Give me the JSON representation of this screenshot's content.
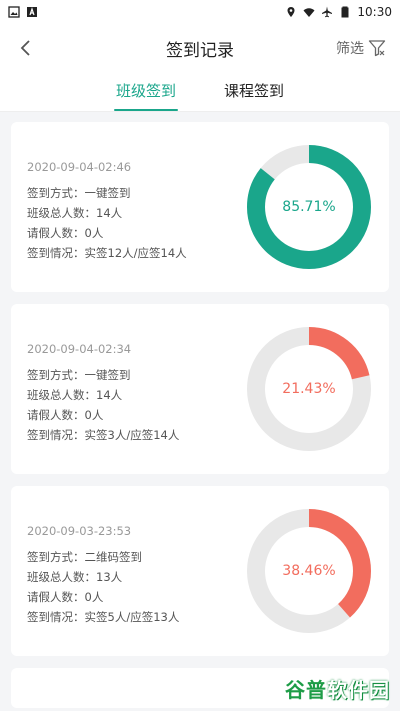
{
  "status_bar": {
    "time": "10:30"
  },
  "nav": {
    "title": "签到记录",
    "filter_label": "筛选"
  },
  "tabs": [
    {
      "label": "班级签到",
      "active": true
    },
    {
      "label": "课程签到",
      "active": false
    }
  ],
  "records": [
    {
      "datetime": "2020-09-04-02:46",
      "method": "签到方式：一键签到",
      "total": "班级总人数：14人",
      "leave": "请假人数：0人",
      "status": "签到情况：实签12人/应签14人",
      "percent_label": "85.71%",
      "rate": 0.8571,
      "color": "#1aa68b"
    },
    {
      "datetime": "2020-09-04-02:34",
      "method": "签到方式：一键签到",
      "total": "班级总人数：14人",
      "leave": "请假人数：0人",
      "status": "签到情况：实签3人/应签14人",
      "percent_label": "21.43%",
      "rate": 0.2143,
      "color": "#f26d5e"
    },
    {
      "datetime": "2020-09-03-23:53",
      "method": "签到方式：二维码签到",
      "total": "班级总人数：13人",
      "leave": "请假人数：0人",
      "status": "签到情况：实签5人/应签13人",
      "percent_label": "38.46%",
      "rate": 0.3846,
      "color": "#f26d5e"
    }
  ],
  "colors": {
    "accent": "#1aa68b",
    "low": "#f26d5e",
    "track": "#e8e8e8"
  },
  "watermark": {
    "prefix": "谷普",
    "suffix": "软件园"
  }
}
